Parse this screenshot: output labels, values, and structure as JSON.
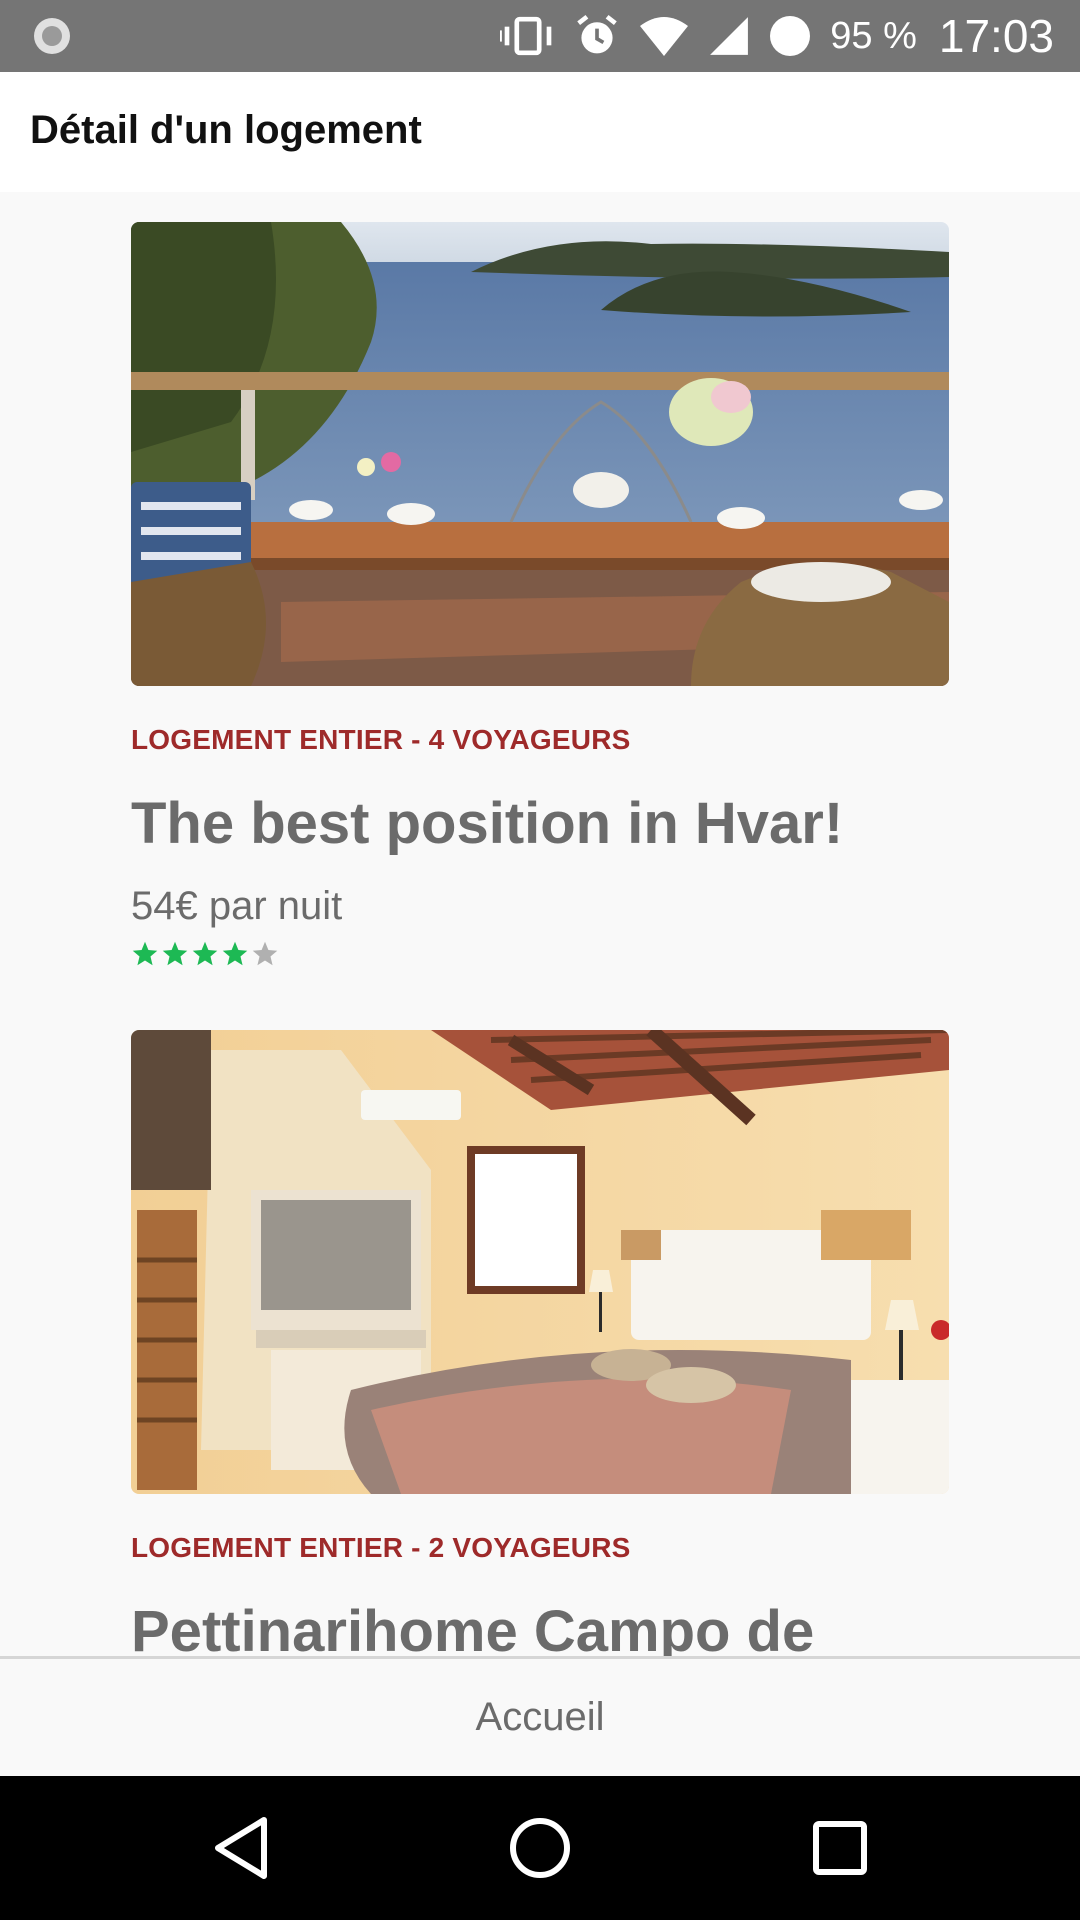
{
  "status_bar": {
    "battery_percent": "95 %",
    "time": "17:03",
    "icons": [
      "record-icon",
      "vibrate-icon",
      "alarm-icon",
      "wifi-icon",
      "signal-icon",
      "battery-icon"
    ]
  },
  "header": {
    "title": "Détail d'un logement"
  },
  "listings": [
    {
      "image": "terrace-sea-view-photo",
      "type": "LOGEMENT ENTIER - 4 VOYAGEURS",
      "name": "The best position in Hvar!",
      "price": "54€ par nuit",
      "rating": 4,
      "rating_max": 5
    },
    {
      "image": "bedroom-photo",
      "type": "LOGEMENT ENTIER - 2 VOYAGEURS",
      "name": "Pettinarihome Campo de"
    }
  ],
  "bottom_tab": {
    "label": "Accueil"
  },
  "colors": {
    "status_bar": "#757575",
    "accent_red": "#9e2a2a",
    "star_filled": "#1db954",
    "star_empty": "#b0b0b0",
    "text_gray": "#6b6b6b"
  },
  "nav_bar": {
    "icons": [
      "back-icon",
      "home-icon",
      "recents-icon"
    ]
  }
}
